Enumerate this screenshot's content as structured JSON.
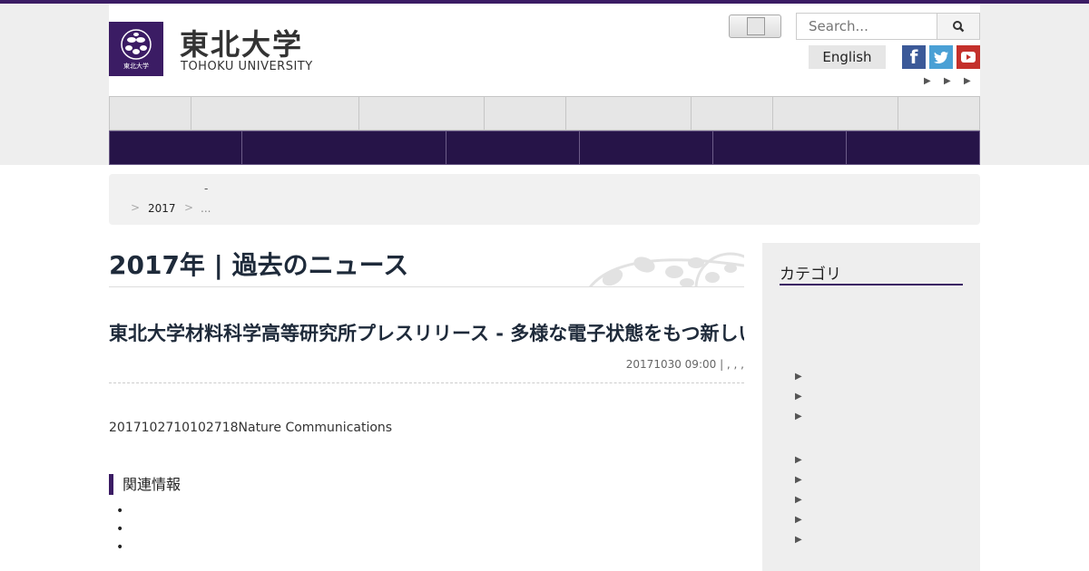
{
  "header": {
    "logo_small_text": "東北大学",
    "logo_jp": "東北大学",
    "logo_en": "TOHOKU UNIVERSITY",
    "search_placeholder": "Search...",
    "search_button_icon": "search-icon",
    "english_label": "English",
    "social": [
      {
        "name": "facebook-icon",
        "glyph": "f",
        "color": "#3b5998"
      },
      {
        "name": "twitter-icon",
        "glyph": "t",
        "color": "#4aa0d5"
      },
      {
        "name": "youtube-icon",
        "glyph": "▶",
        "color": "#c4302b"
      }
    ],
    "util_arrows": [
      "▶",
      "▶",
      "▶"
    ]
  },
  "colors": {
    "brand_purple": "#3b1c64",
    "nav_dark": "#261448",
    "nav_light": "#e6e6e6",
    "page_bg": "#eeeeee"
  },
  "breadcrumb": {
    "dash": "-",
    "sep": ">",
    "year": "2017",
    "ellipsis": "..."
  },
  "page": {
    "title": "2017年 | 過去のニュース"
  },
  "article": {
    "title": "東北大学材料科学高等研究所プレスリリース - 多様な電子状態をもつ新しい磁性体の物性を解明する -",
    "meta": "20171030 09:00 |  ,  ,     ,",
    "body": "2017102710102718Nature Communications",
    "section_title": "関連情報",
    "bullets": [
      "•",
      "•",
      "•"
    ]
  },
  "sidebar": {
    "title": "カテゴリ",
    "arrows": [
      "▶",
      "▶",
      "▶",
      "▶",
      "▶",
      "▶",
      "▶",
      "▶"
    ]
  }
}
